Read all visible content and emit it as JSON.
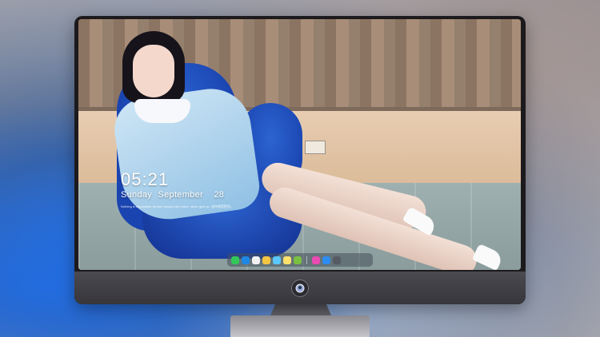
{
  "lockscreen": {
    "time": "05:21",
    "weekday": "Sunday",
    "month": "September",
    "day": "28",
    "quote": "Nothing is impossible, fortune favours the brave, never give up. 坚持就是胜利。"
  },
  "dock": {
    "icons": [
      {
        "name": "messages-icon",
        "color": "#34c759"
      },
      {
        "name": "finder-icon",
        "color": "#1e88e5"
      },
      {
        "name": "clock-icon",
        "color": "#f2f2f2"
      },
      {
        "name": "notes-icon",
        "color": "#f4c542"
      },
      {
        "name": "mail-icon",
        "color": "#5ac8fa"
      },
      {
        "name": "stickies-icon",
        "color": "#ffe16b"
      },
      {
        "name": "photos-icon",
        "color": "#7ac142"
      },
      {
        "name": "music-icon",
        "color": "#e84bb1"
      },
      {
        "name": "app-store-icon",
        "color": "#2d8cf0"
      },
      {
        "name": "camera-icon",
        "color": "#555a63"
      }
    ]
  },
  "monitor": {
    "logo": "hatsune-logo-icon"
  }
}
